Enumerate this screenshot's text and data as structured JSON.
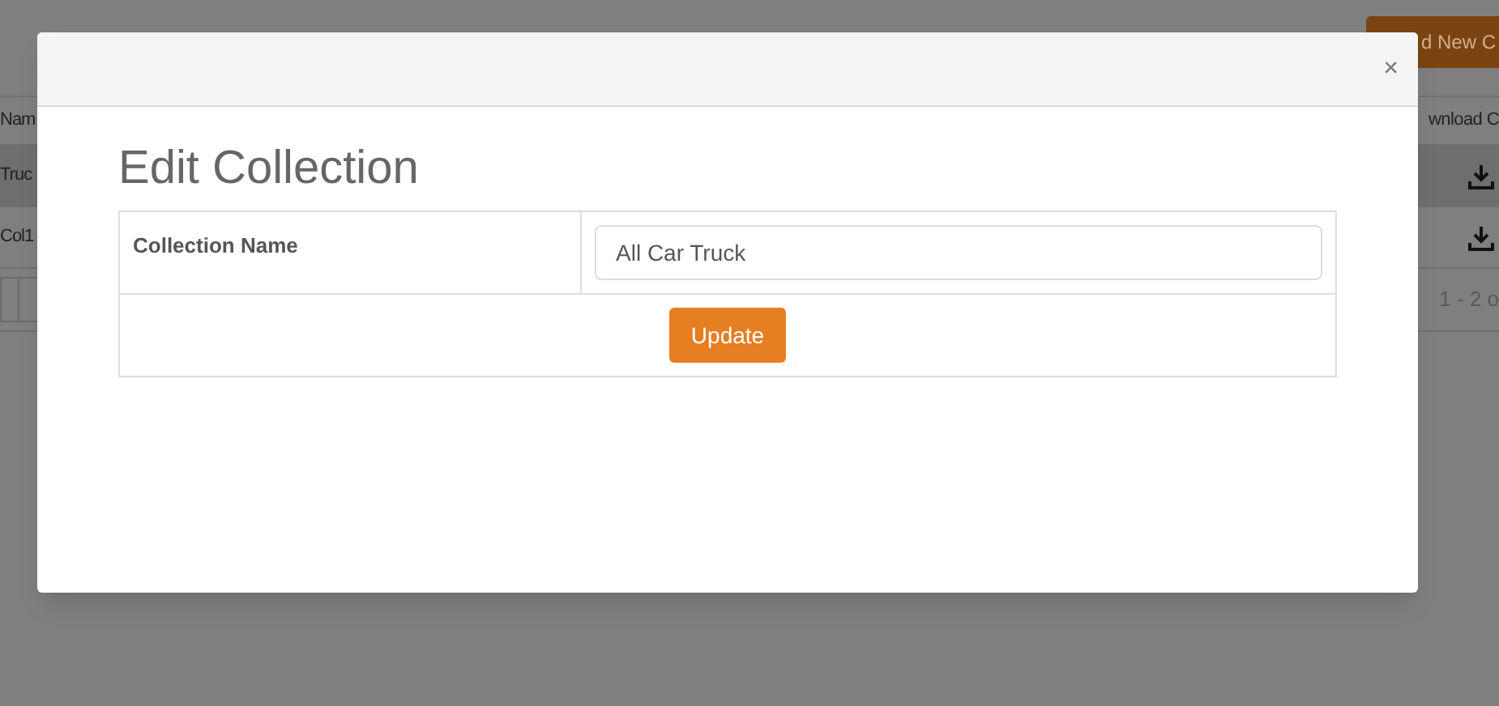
{
  "background": {
    "add_button": "d New C",
    "table": {
      "columns": [
        "Nam",
        "wnload C"
      ],
      "rows": [
        {
          "column_1": "Truc",
          "selected": true
        },
        {
          "column_1": "Col1",
          "selected": false
        }
      ]
    },
    "pager": {
      "range": "1 - 2 o"
    }
  },
  "dialog": {
    "close": "×",
    "title": "Edit Collection",
    "fields": [
      {
        "label": "Collection Name",
        "value": "All Car Truck"
      }
    ],
    "submit": "Update"
  }
}
